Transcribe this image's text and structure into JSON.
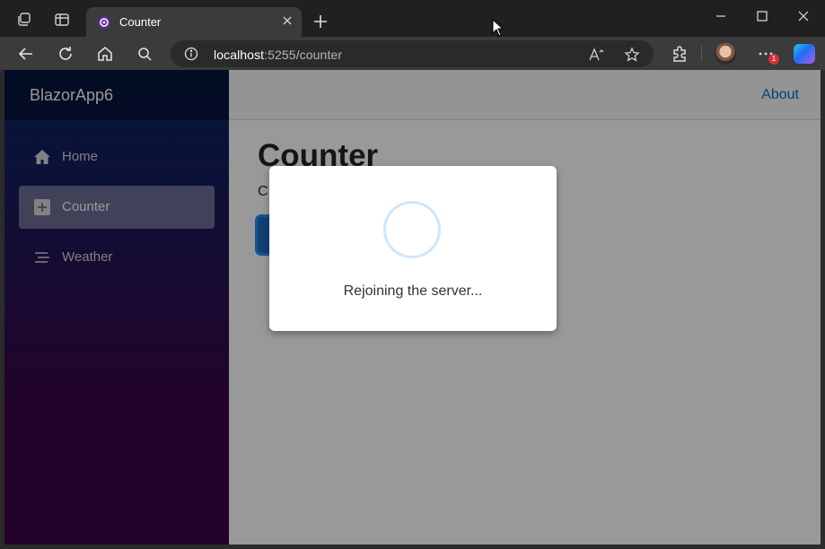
{
  "browser": {
    "tab": {
      "title": "Counter"
    },
    "address": {
      "host": "localhost",
      "rest": ":5255/counter"
    },
    "notification_badge": "1"
  },
  "app": {
    "brand": "BlazorApp6",
    "nav": [
      {
        "label": "Home",
        "icon": "home-icon",
        "active": false
      },
      {
        "label": "Counter",
        "icon": "plus-square-icon",
        "active": true
      },
      {
        "label": "Weather",
        "icon": "list-icon",
        "active": false
      }
    ],
    "top_row": {
      "about_label": "About"
    },
    "page": {
      "title": "Counter",
      "count_text": "C"
    }
  },
  "dialog": {
    "message": "Rejoining the server..."
  },
  "colors": {
    "sidebar_top": "#052767",
    "sidebar_bottom": "#3a0647",
    "link": "#0071c1",
    "primary_button": "#1b6ec2"
  }
}
